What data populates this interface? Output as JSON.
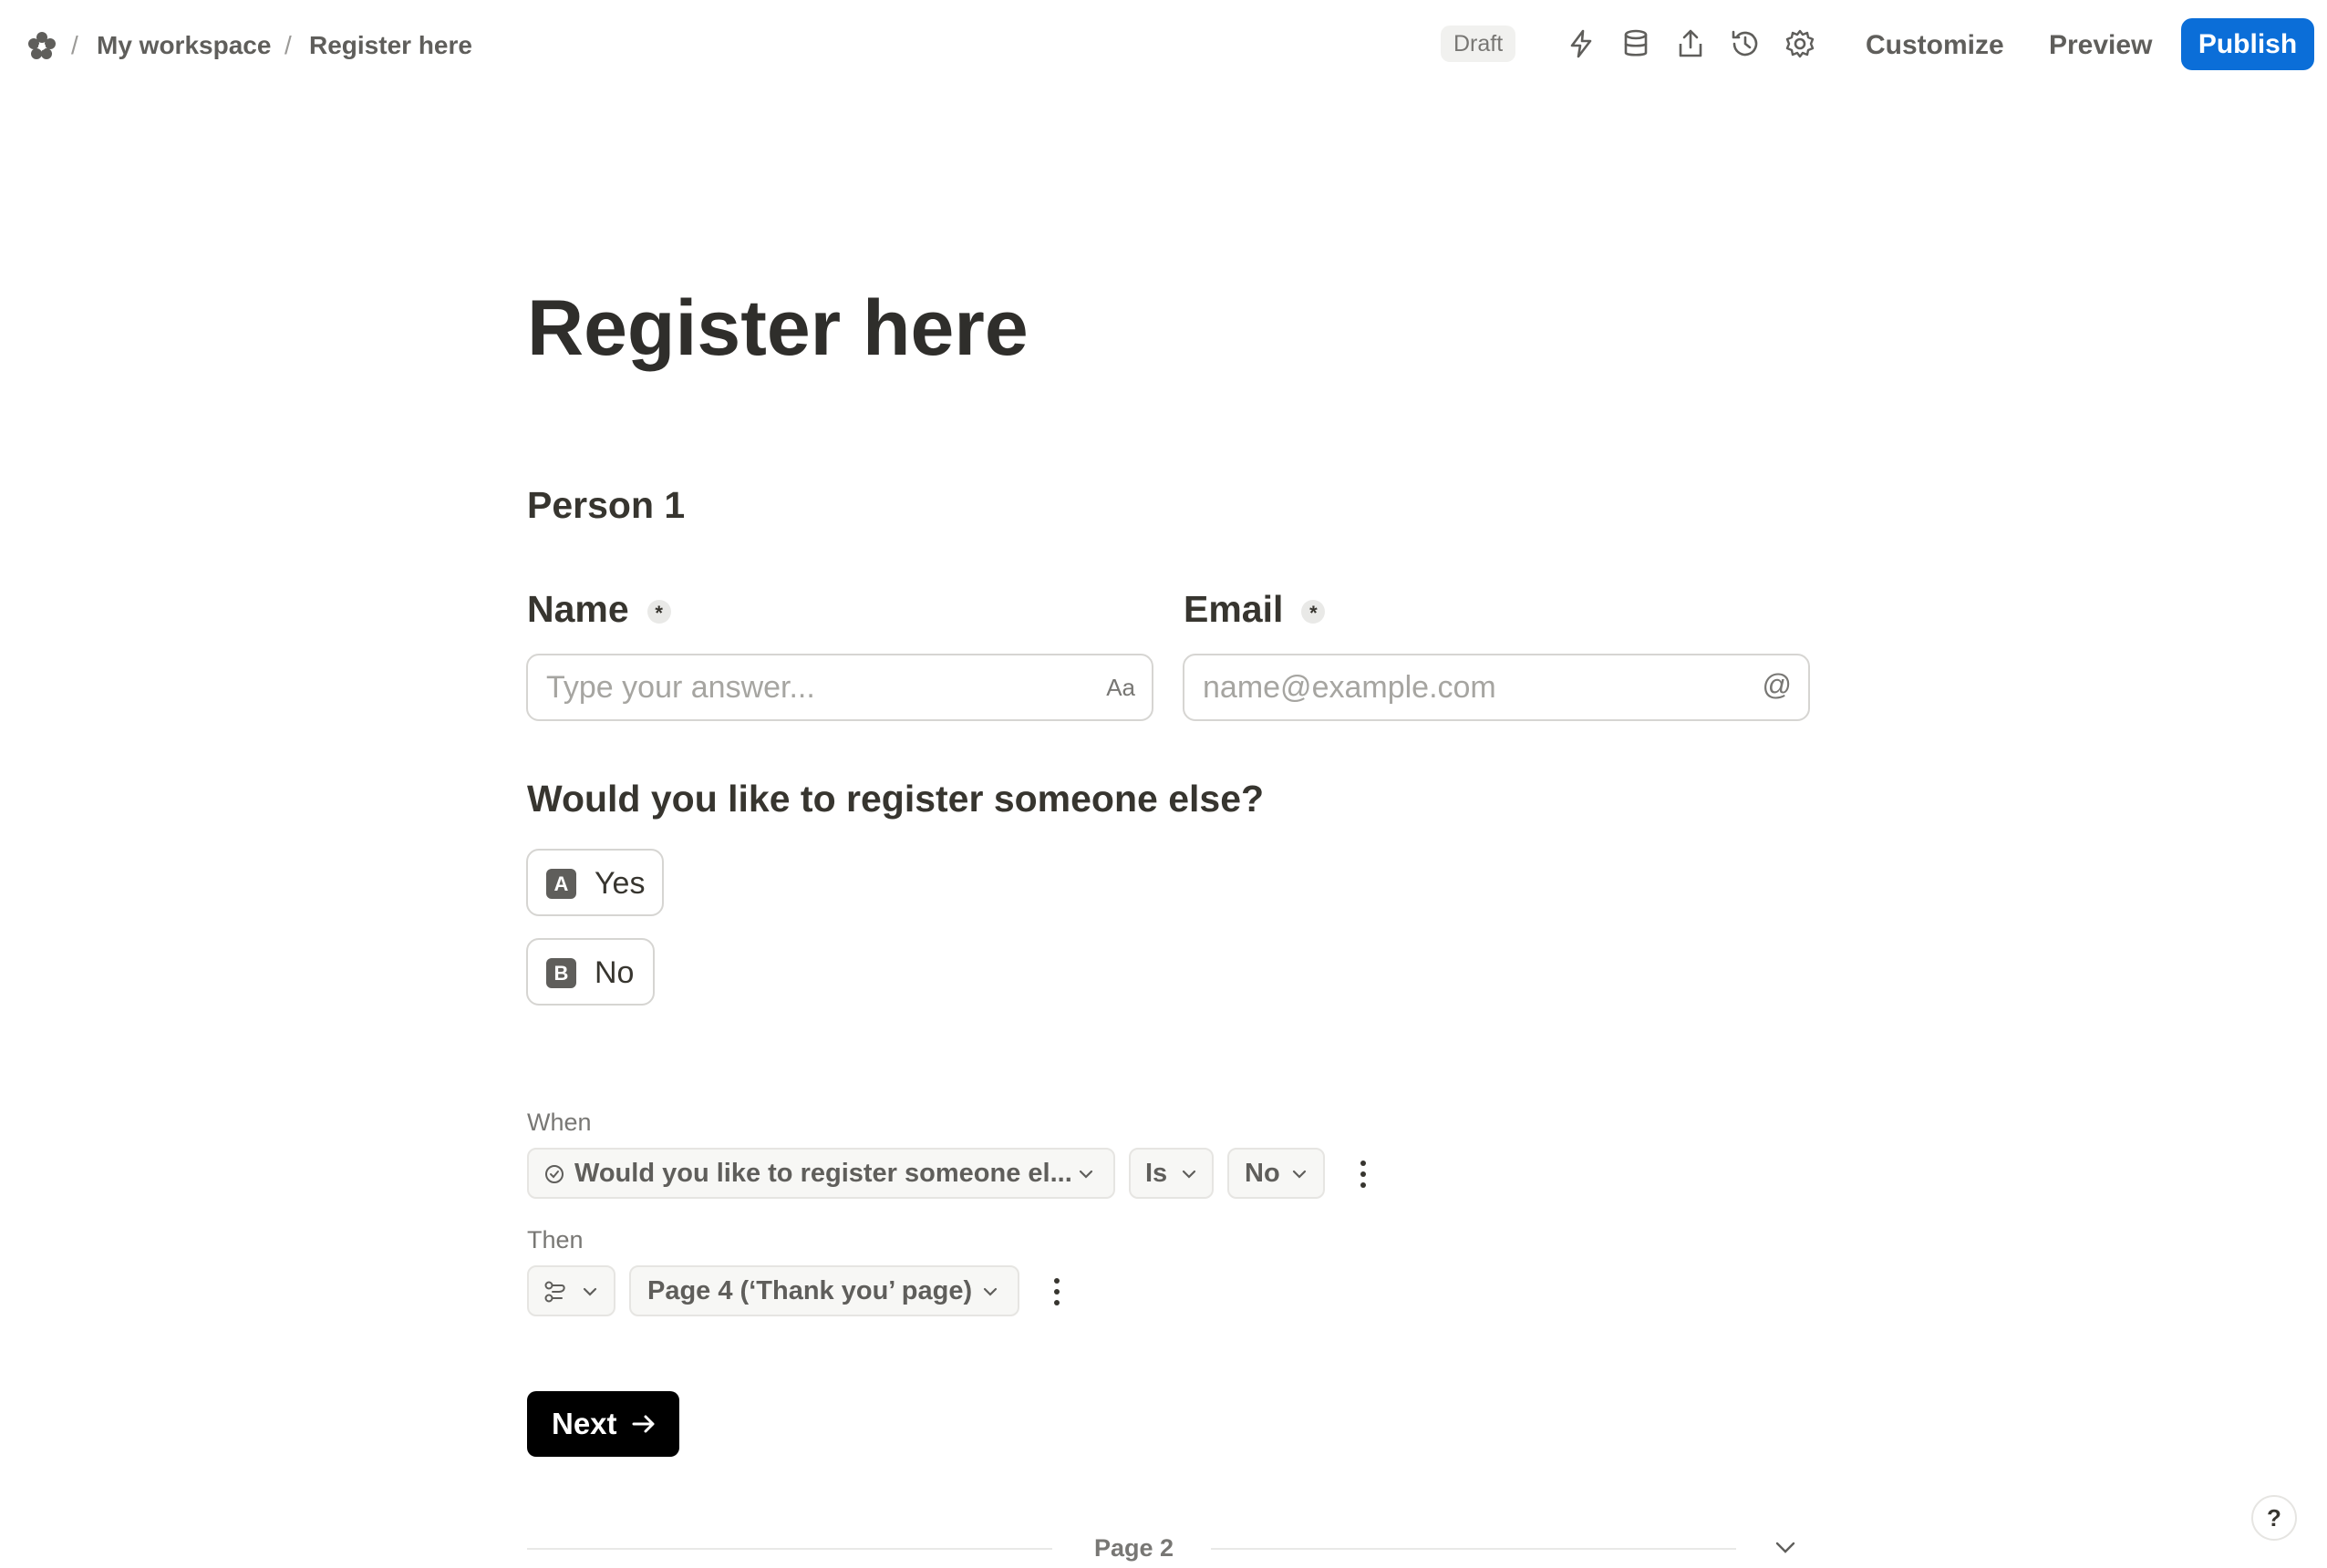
{
  "breadcrumb": {
    "workspace": "My workspace",
    "page": "Register here",
    "separator": "/"
  },
  "header": {
    "status": "Draft",
    "customize_label": "Customize",
    "preview_label": "Preview",
    "publish_label": "Publish",
    "icons": [
      "automation-bolt-icon",
      "database-icon",
      "share-icon",
      "history-icon",
      "settings-gear-icon"
    ]
  },
  "colors": {
    "publish": "#0b6ed8",
    "next_button": "#000000",
    "text": "#37352f",
    "muted": "#787774"
  },
  "form": {
    "title": "Register here",
    "section": "Person 1",
    "required_marker": "*",
    "fields": {
      "name": {
        "label": "Name",
        "placeholder": "Type your answer...",
        "value": "",
        "trail": "Aa"
      },
      "email": {
        "label": "Email",
        "placeholder": "name@example.com",
        "value": "",
        "trail": "@"
      }
    },
    "question": {
      "text": "Would you like to register someone else?",
      "options": [
        {
          "key": "A",
          "label": "Yes"
        },
        {
          "key": "B",
          "label": "No"
        }
      ]
    }
  },
  "logic": {
    "when_label": "When",
    "condition_field": "Would you like to register someone el...",
    "operator": "Is",
    "value": "No",
    "then_label": "Then",
    "target": "Page 4 (‘Thank you’ page)"
  },
  "next_label": "Next",
  "page_label": "Page 2",
  "help_label": "?"
}
